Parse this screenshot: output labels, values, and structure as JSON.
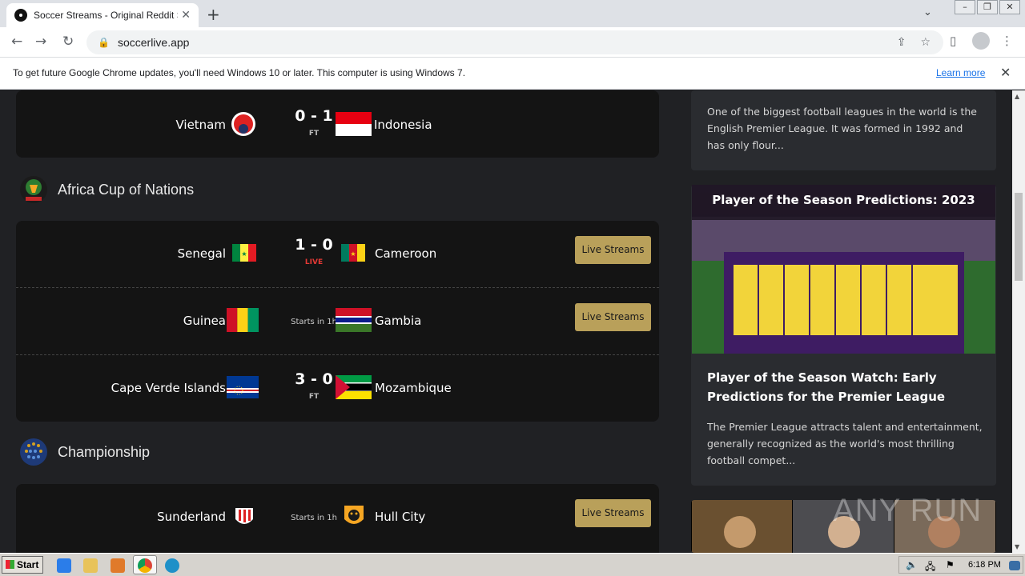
{
  "browser": {
    "tab_title": "Soccer Streams - Original Reddit Soc",
    "url": "soccerlive.app",
    "infobar_message": "To get future Google Chrome updates, you'll need Windows 10 or later. This computer is using Windows 7.",
    "infobar_link": "Learn more"
  },
  "matches_top": [
    {
      "home": "Vietnam",
      "away": "Indonesia",
      "score": "0 - 1",
      "status": "FT"
    }
  ],
  "leagues": [
    {
      "name": "Africa Cup of Nations",
      "matches": [
        {
          "home": "Senegal",
          "away": "Cameroon",
          "score": "1 - 0",
          "status": "LIVE",
          "button": "Live Streams"
        },
        {
          "home": "Guinea",
          "away": "Gambia",
          "starts": "Starts in 1h",
          "button": "Live Streams"
        },
        {
          "home": "Cape Verde Islands",
          "away": "Mozambique",
          "score": "3 - 0",
          "status": "FT"
        }
      ]
    },
    {
      "name": "Championship",
      "matches": [
        {
          "home": "Sunderland",
          "away": "Hull City",
          "starts": "Starts in 1h",
          "button": "Live Streams"
        }
      ]
    }
  ],
  "sidebar": {
    "article1_excerpt": "One of the biggest football leagues in the world is the English Premier League. It was formed in 1992 and has only flour...",
    "article2_image_caption": "Player of the Season Predictions: 2023",
    "article2_title": "Player of the Season Watch: Early Predictions for the Premier League",
    "article2_excerpt": "The Premier League attracts talent and entertainment, generally recognized as the world's most thrilling football compet..."
  },
  "taskbar": {
    "start_label": "Start",
    "clock": "6:18 PM"
  },
  "watermark": "ANY RUN"
}
